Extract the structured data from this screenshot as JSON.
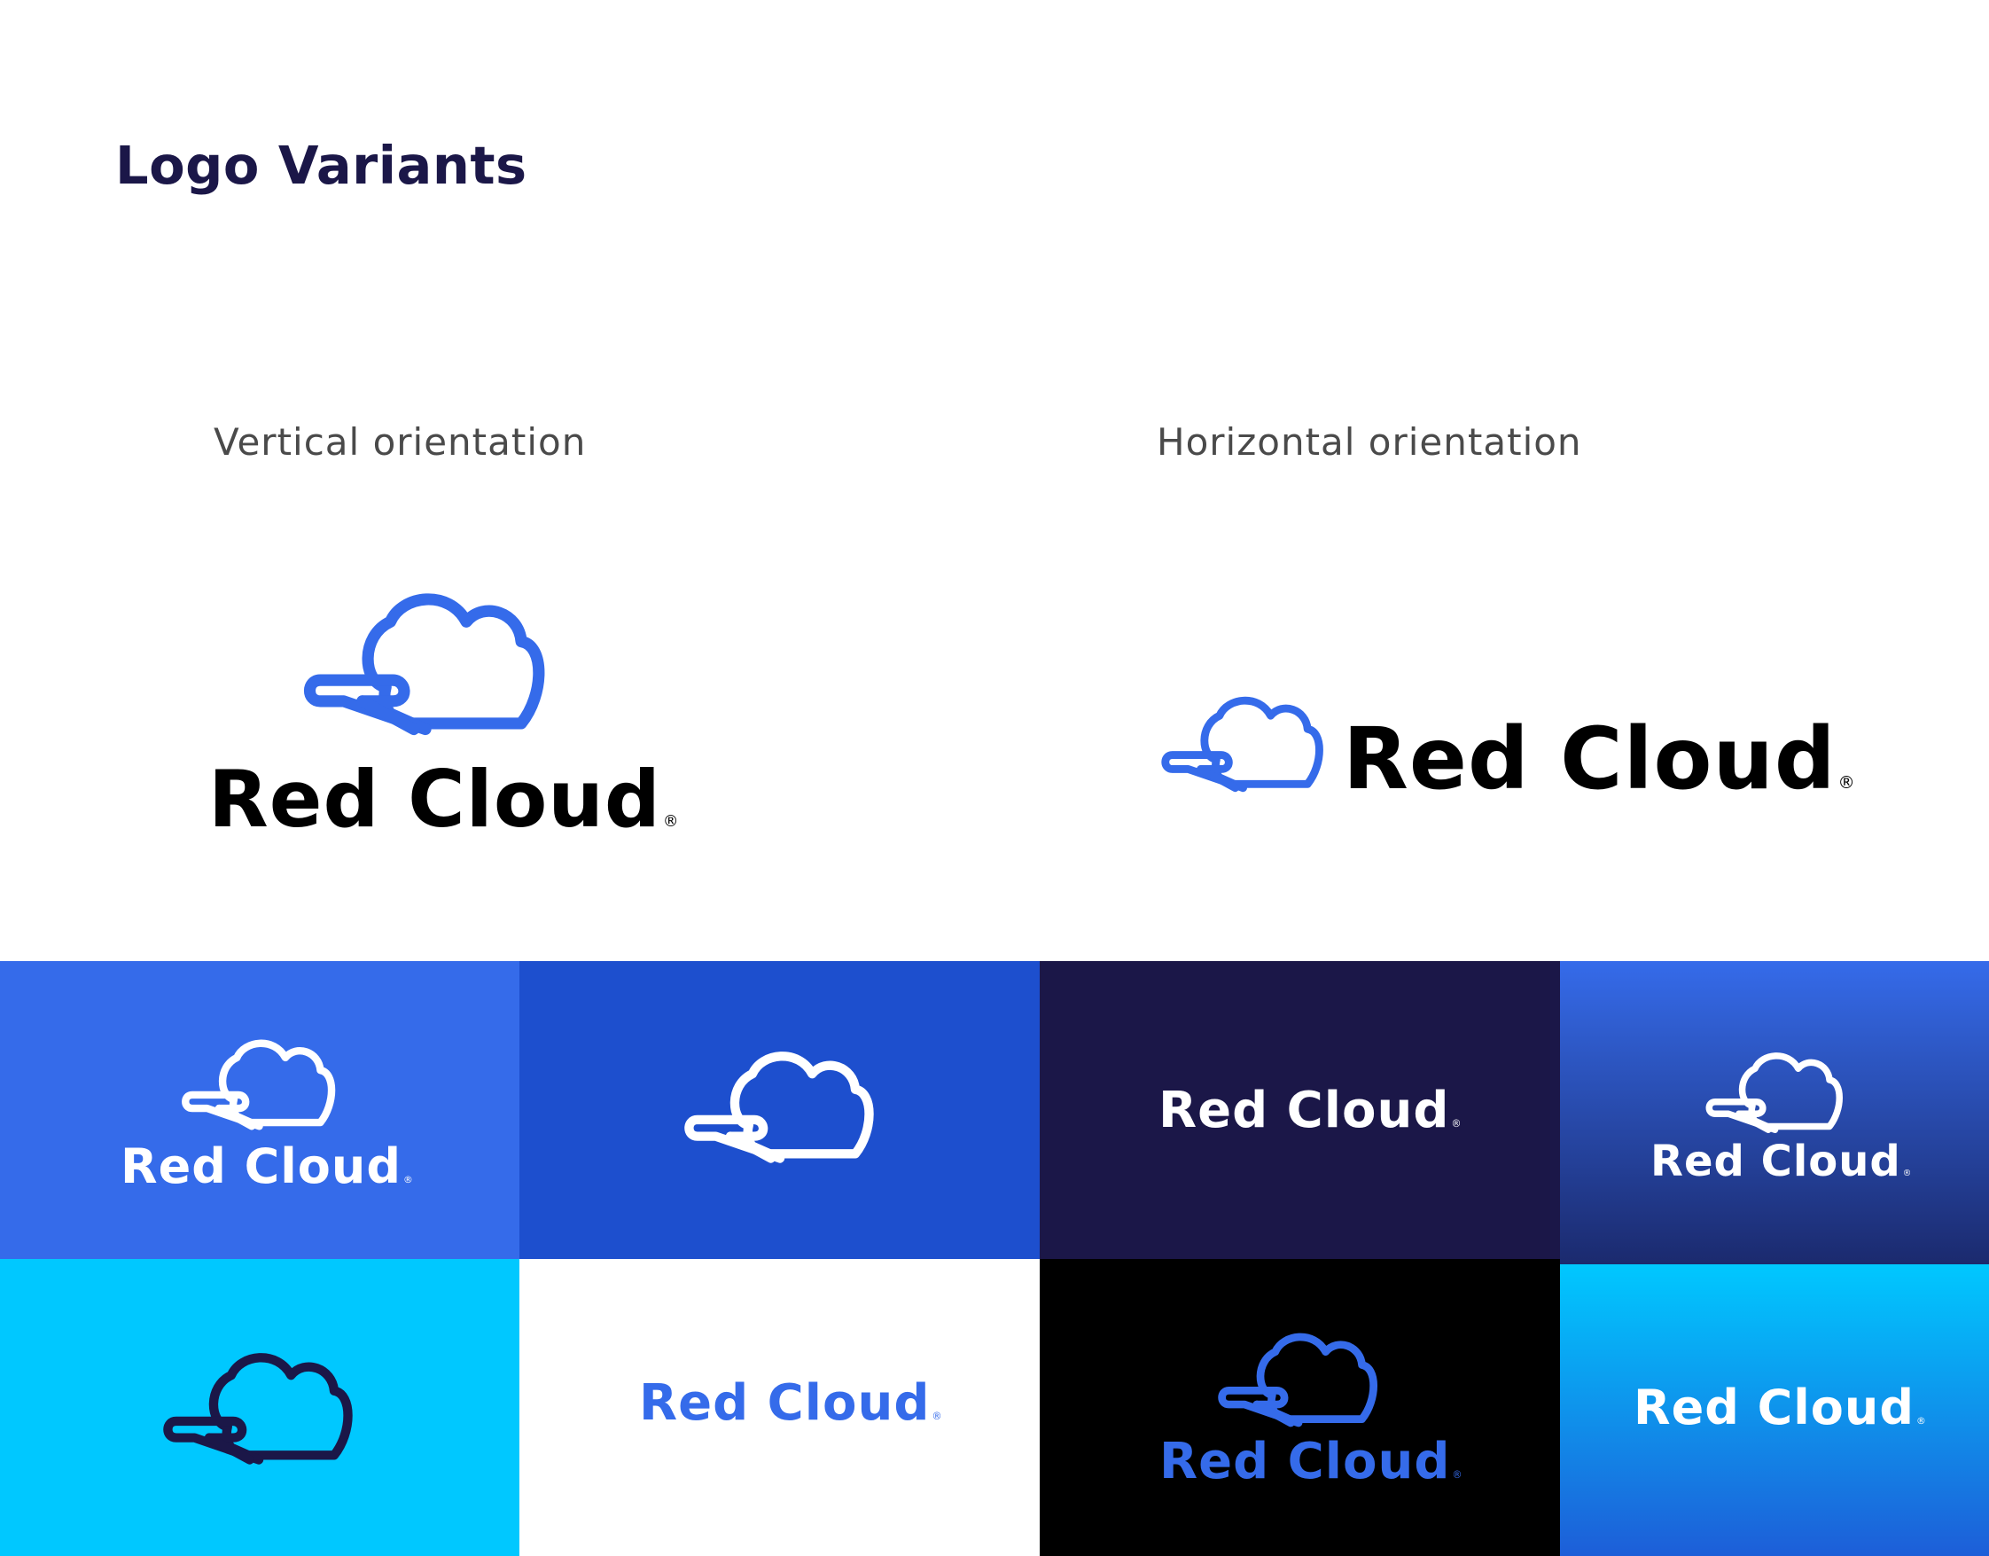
{
  "page": {
    "title": "Logo Variants"
  },
  "orientations": {
    "vertical_label": "Vertical orientation",
    "horizontal_label": "Horizontal orientation"
  },
  "brand": {
    "name": "Red Cloud",
    "registered": "®"
  },
  "colors": {
    "brand_blue": "#356bea",
    "royal_blue": "#1d4fce",
    "navy": "#1b1748",
    "cyan": "#00c8ff",
    "black": "#000000",
    "white": "#ffffff"
  },
  "tiles": [
    {
      "variant": "stacked-white-on-blue",
      "background": "#356bea"
    },
    {
      "variant": "icon-white-on-royal-blue",
      "background": "#1d4fce"
    },
    {
      "variant": "wordmark-white-on-navy",
      "background": "#1b1748"
    },
    {
      "variant": "stacked-white-on-blue-navy-gradient",
      "background": "linear-gradient(#356bea, #1b2a6e)"
    },
    {
      "variant": "icon-navy-on-cyan",
      "background": "#00c8ff"
    },
    {
      "variant": "wordmark-blue-on-white",
      "background": "#ffffff"
    },
    {
      "variant": "stacked-blue-on-black",
      "background": "#000000"
    },
    {
      "variant": "wordmark-white-on-cyan-blue-gradient",
      "background": "linear-gradient(#00c8ff, #1d5ed8)"
    }
  ]
}
